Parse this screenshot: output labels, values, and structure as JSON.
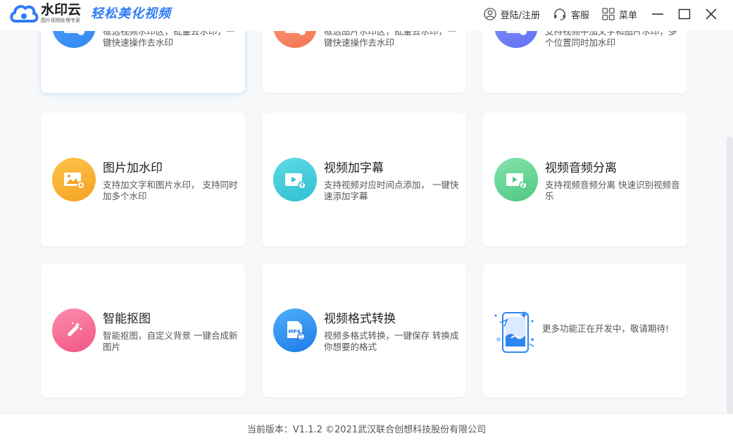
{
  "header": {
    "app_name": "水印云",
    "app_subtitle": "图片视频处理专家",
    "slogan": "轻松美化视频",
    "login_label": "登陆/注册",
    "service_label": "客服",
    "menu_label": "菜单"
  },
  "cards": [
    {
      "id": "video-watermark-remove",
      "title": "",
      "desc": "框选视频水印区，批量去水印，一键快速操作去水印",
      "color": "#2f86f0"
    },
    {
      "id": "image-watermark-remove",
      "title": "",
      "desc": "框选图片水印区，批量去水印，一键快速操作去水印",
      "color": "#f47f5b"
    },
    {
      "id": "video-add-watermark",
      "title": "",
      "desc": "支持视频中加文字和图片水印，多个位置同时加水印",
      "color": "#6b7bf5"
    },
    {
      "id": "image-add-watermark",
      "title": "图片加水印",
      "desc": "支持加文字和图片水印， 支持同时加多个水印",
      "color": "#f7ab2c"
    },
    {
      "id": "video-add-subtitle",
      "title": "视频加字幕",
      "desc": "支持视频对应时间点添加， 一键快速添加字幕",
      "color": "#36c7d6"
    },
    {
      "id": "video-audio-separate",
      "title": "视频音频分离",
      "desc": "支持视频音频分离 快速识别视频音乐",
      "color": "#5ed08d"
    },
    {
      "id": "smart-cutout",
      "title": "智能抠图",
      "desc": "智能抠图，自定义背景 一键合成新图片",
      "color": "#f5668f"
    },
    {
      "id": "video-format-convert",
      "title": "视频格式转换",
      "desc": "视频多格式转换，一键保存 转换成你想要的格式",
      "color": "#2b8ef0"
    },
    {
      "id": "more-features",
      "title": "",
      "desc": "更多功能正在开发中，敬请期待!",
      "color": "#2f86f0"
    }
  ],
  "icons": {
    "mp4_label": "MP4"
  },
  "footer": {
    "version_text": "当前版本：V1.1.2 ©2021武汉联合创想科技股份有限公司"
  }
}
